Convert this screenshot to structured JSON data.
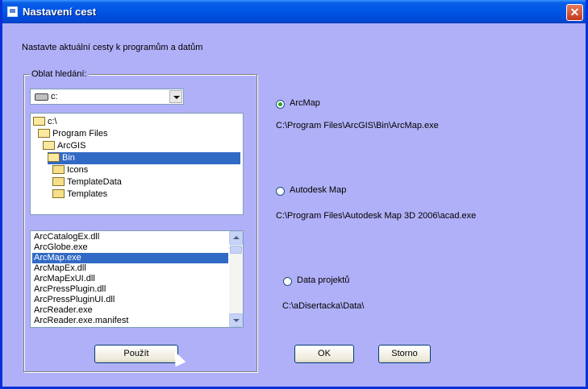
{
  "window": {
    "title": "Nastavení cest"
  },
  "instruction": "Nastavte aktuální cesty k programům a datům",
  "search": {
    "legend": "Oblat hledání:",
    "drive": "c:",
    "folders": [
      {
        "label": "c:\\",
        "indent": 0,
        "open": true,
        "selected": false
      },
      {
        "label": "Program Files",
        "indent": 1,
        "open": true,
        "selected": false
      },
      {
        "label": "ArcGIS",
        "indent": 2,
        "open": true,
        "selected": false
      },
      {
        "label": "Bin",
        "indent": 3,
        "open": true,
        "selected": true
      },
      {
        "label": "Icons",
        "indent": 4,
        "open": false,
        "selected": false
      },
      {
        "label": "TemplateData",
        "indent": 4,
        "open": false,
        "selected": false
      },
      {
        "label": "Templates",
        "indent": 4,
        "open": false,
        "selected": false
      }
    ],
    "files": [
      "ArcCatalogEx.dll",
      "ArcGlobe.exe",
      "ArcMap.exe",
      "ArcMapEx.dll",
      "ArcMapExUI.dll",
      "ArcPressPlugin.dll",
      "ArcPressPluginUI.dll",
      "ArcReader.exe",
      "ArcReader.exe.manifest"
    ],
    "selected_file": "ArcMap.exe",
    "use_button": "Použít"
  },
  "options": [
    {
      "label": "ArcMap",
      "path": "C:\\Program Files\\ArcGIS\\Bin\\ArcMap.exe",
      "checked": true
    },
    {
      "label": "Autodesk Map",
      "path": "C:\\Program Files\\Autodesk Map 3D 2006\\acad.exe",
      "checked": false
    },
    {
      "label": "Data projektů",
      "path": "C:\\aDisertacka\\Data\\",
      "checked": false
    }
  ],
  "buttons": {
    "ok": "OK",
    "cancel": "Storno"
  },
  "colors": {
    "client_bg": "#b0b0f8",
    "selection": "#316ac5",
    "titlebar": "#0055e5"
  }
}
